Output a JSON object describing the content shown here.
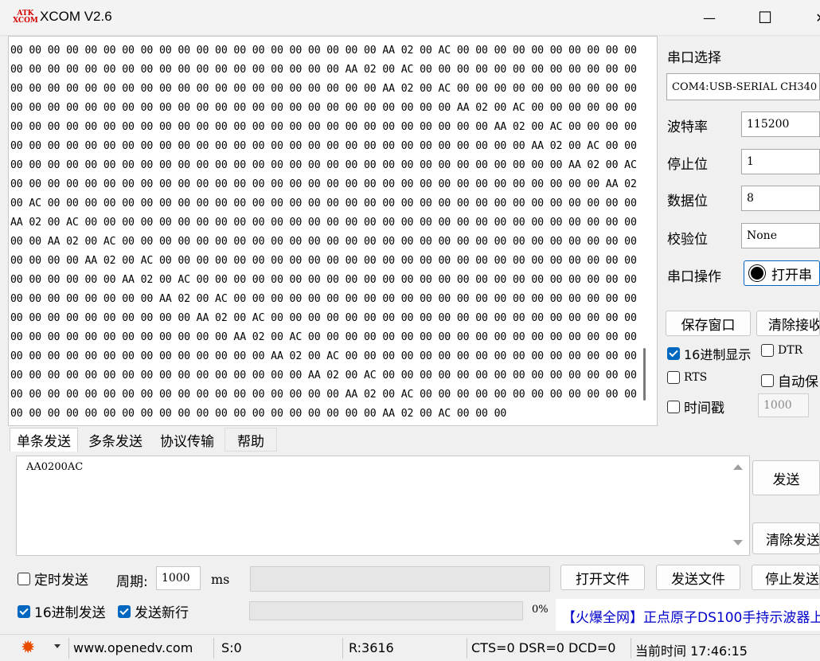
{
  "window": {
    "title": "XCOM V2.6",
    "icon_text_top": "ATK",
    "icon_text_bottom": "XCOM",
    "minimize_glyph": "—",
    "maximize_glyph": "☐",
    "close_glyph": "✕"
  },
  "receive": {
    "text": "00 00 00 00 00 00 00 00 00 00 00 00 00 00 00 00 00 00 00 00 AA 02 00 AC 00 00 00 00 00 00 00 00 00 00 00 00 00 00 00 00 00 00 00 00 00 00 00 00 00 00 00 00 AA 02 00 AC 00 00 00 00 00 00 00 00 00 00 00 00 00 00 00 00 00 00 00 00 00 00 00 00 00 00 00 00 00 00 00 00 AA 02 00 AC 00 00 00 00 00 00 00 00 00 00 00 00 00 00 00 00 00 00 00 00 00 00 00 00 00 00 00 00 00 00 00 00 00 00 AA 02 00 AC 00 00 00 00 00 00 00 00 00 00 00 00 00 00 00 00 00 00 00 00 00 00 00 00 00 00 00 00 00 00 00 00 AA 02 00 AC 00 00 00 00 00 00 00 00 00 00 00 00 00 00 00 00 00 00 00 00 00 00 00 00 00 00 00 00 00 00 00 00 AA 02 00 AC 00 00 00 00 00 00 00 00 00 00 00 00 00 00 00 00 00 00 00 00 00 00 00 00 00 00 00 00 00 00 00 00 AA 02 00 AC 00 00 00 00 00 00 00 00 00 00 00 00 00 00 00 00 00 00 00 00 00 00 00 00 00 00 00 00 00 00 00 00 AA 02 00 AC 00 00 00 00 00 00 00 00 00 00 00 00 00 00 00 00 00 00 00 00 00 00 00 00 00 00 00 00 00 00 00 00 AA 02 00 AC 00 00 00 00 00 00 00 00 00 00 00 00 00 00 00 00 00 00 00 00 00 00 00 00 00 00 00 00 00 00 00 00 AA 02 00 AC 00 00 00 00 00 00 00 00 00 00 00 00 00 00 00 00 00 00 00 00 00 00 00 00 00 00 00 00 00 00 00 00 AA 02 00 AC 00 00 00 00 00 00 00 00 00 00 00 00 00 00 00 00 00 00 00 00 00 00 00 00 00 00 00 00 00 00 00 00 AA 02 00 AC 00 00 00 00 00 00 00 00 00 00 00 00 00 00 00 00 00 00 00 00 00 00 00 00 00 00 00 00 00 00 00 00 AA 02 00 AC 00 00 00 00 00 00 00 00 00 00 00 00 00 00 00 00 00 00 00 00 00 00 00 00 00 00 00 00 00 00 00 00 AA 02 00 AC 00 00 00 00 00 00 00 00 00 00 00 00 00 00 00 00 00 00 00 00 00 00 00 00 00 00 00 00 00 00 00 00 AA 02 00 AC 00 00 00 00 00 00 00 00 00 00 00 00 00 00 00 00 00 00 00 00 00 00 00 00 00 00 00 00 00 00 00 00 AA 02 00 AC 00 00 00 00 00 00 00 00 00 00 00 00 00 00 00 00 00 00 00 00 00 00 00 00 00 00 00 00 00 00 00 00 AA 02 00 AC 00 00 00 00 00 00 00 00 00 00 00 00 00 00 00 00 00 00 00 00 00 00 00 00 00 00 00 00 00 00 00 00 AA 02 00 AC 00 00 00 00 00 00 00 00 00 00 00 00 00 00 00 00 00 00 00 00 00 00 00 00 00 00 00 00 00 00 00 00 AA 02 00 AC 00 00 00"
  },
  "settings": {
    "port_select_label": "串口选择",
    "port_value": "COM4:USB-SERIAL CH340",
    "baud_label": "波特率",
    "baud_value": "115200",
    "stop_label": "停止位",
    "stop_value": "1",
    "data_label": "数据位",
    "data_value": "8",
    "parity_label": "校验位",
    "parity_value": "None",
    "port_op_label": "串口操作",
    "open_port_button": "打开串",
    "save_window_button": "保存窗口",
    "clear_receive_button": "清除接收",
    "hex_display_label": "16进制显示",
    "hex_display_checked": true,
    "dtr_label": "DTR",
    "dtr_checked": false,
    "rts_label": "RTS",
    "rts_checked": false,
    "auto_save_label": "自动保",
    "auto_save_checked": false,
    "timestamp_label": "时间戳",
    "timestamp_checked": false,
    "timestamp_value": "1000"
  },
  "tabs": [
    "单条发送",
    "多条发送",
    "协议传输",
    "帮助"
  ],
  "send": {
    "text": "AA0200AC",
    "send_button": "发送",
    "clear_send_button": "清除发送",
    "timed_send_label": "定时发送",
    "timed_send_checked": false,
    "period_label": "周期:",
    "period_value": "1000",
    "period_unit": "ms",
    "open_file_button": "打开文件",
    "send_file_button": "发送文件",
    "stop_send_button": "停止发送",
    "hex_send_label": "16进制发送",
    "hex_send_checked": true,
    "send_newline_label": "发送新行",
    "send_newline_checked": true,
    "progress_percent": 0,
    "progress_text": "0%",
    "ad_text": "【火爆全网】正点原子DS100手持示波器上"
  },
  "status": {
    "url": "www.openedv.com",
    "sent": "S:0",
    "received": "R:3616",
    "lines": "CTS=0 DSR=0 DCD=0",
    "time": "当前时间 17:46:15",
    "accent_color": "#e84b00"
  }
}
